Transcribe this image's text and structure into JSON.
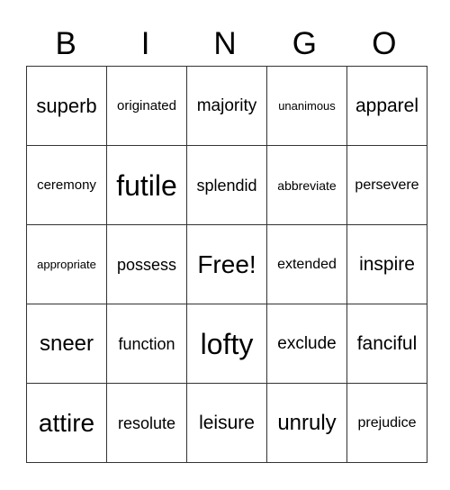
{
  "header": [
    "B",
    "I",
    "N",
    "G",
    "O"
  ],
  "rows": [
    [
      "superb",
      "originated",
      "majority",
      "unanimous",
      "apparel"
    ],
    [
      "ceremony",
      "futile",
      "splendid",
      "abbreviate",
      "persevere"
    ],
    [
      "appropriate",
      "possess",
      "Free!",
      "extended",
      "inspire"
    ],
    [
      "sneer",
      "function",
      "lofty",
      "exclude",
      "fanciful"
    ],
    [
      "attire",
      "resolute",
      "leisure",
      "unruly",
      "prejudice"
    ]
  ]
}
